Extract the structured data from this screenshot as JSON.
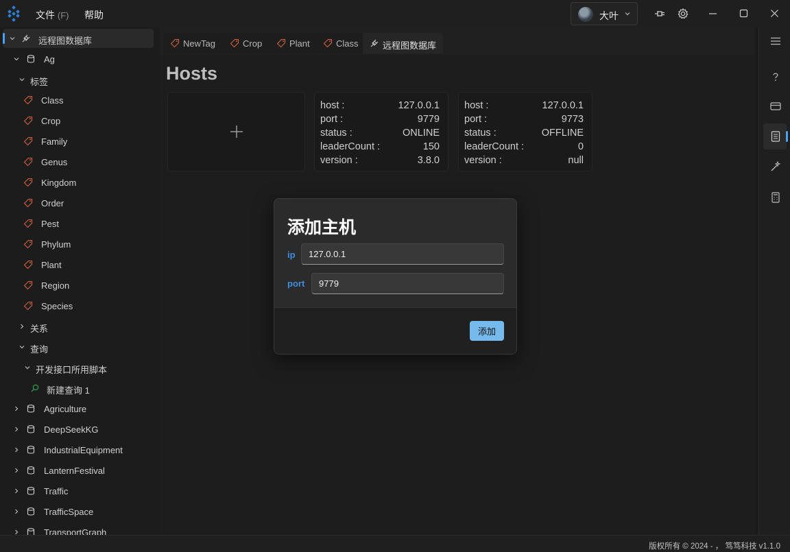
{
  "menu": {
    "file_label": "文件",
    "file_accel": "(F)",
    "help_label": "帮助"
  },
  "user": {
    "name": "大叶"
  },
  "sidebar": {
    "root": "远程图数据库",
    "space_ag": "Ag",
    "tags_group": "标签",
    "tags": [
      "Class",
      "Crop",
      "Family",
      "Genus",
      "Kingdom",
      "Order",
      "Pest",
      "Phylum",
      "Plant",
      "Region",
      "Species"
    ],
    "relations_group": "关系",
    "query_group": "查询",
    "query_folder": "开发接口所用脚本",
    "query_item": "新建查询 1",
    "spaces": [
      "Agriculture",
      "DeepSeekKG",
      "IndustrialEquipment",
      "LanternFestival",
      "Traffic",
      "TrafficSpace",
      "TransportGraph"
    ]
  },
  "tabs": [
    "NewTag",
    "Crop",
    "Plant",
    "Class",
    "远程图数据库"
  ],
  "page": {
    "title": "Hosts"
  },
  "hosts": [
    {
      "host_label": "host :",
      "host": "127.0.0.1",
      "port_label": "port :",
      "port": "9779",
      "status_label": "status :",
      "status": "ONLINE",
      "leader_label": "leaderCount :",
      "leaderCount": "150",
      "version_label": "version :",
      "version": "3.8.0"
    },
    {
      "host_label": "host :",
      "host": "127.0.0.1",
      "port_label": "port :",
      "port": "9773",
      "status_label": "status :",
      "status": "OFFLINE",
      "leader_label": "leaderCount :",
      "leaderCount": "0",
      "version_label": "version :",
      "version": "null"
    }
  ],
  "dialog": {
    "title": "添加主机",
    "ip_label": "ip",
    "ip_value": "127.0.0.1",
    "port_label": "port",
    "port_value": "9779",
    "submit_label": "添加"
  },
  "status_bar": {
    "text": "版权所有 © 2024 - ， 笃笃科技  v1.1.0"
  },
  "colors": {
    "accent": "#4aa3f0",
    "tag_icon": "#d2633a",
    "primary_button": "#76b9ed",
    "field_label": "#3d8fe0"
  }
}
